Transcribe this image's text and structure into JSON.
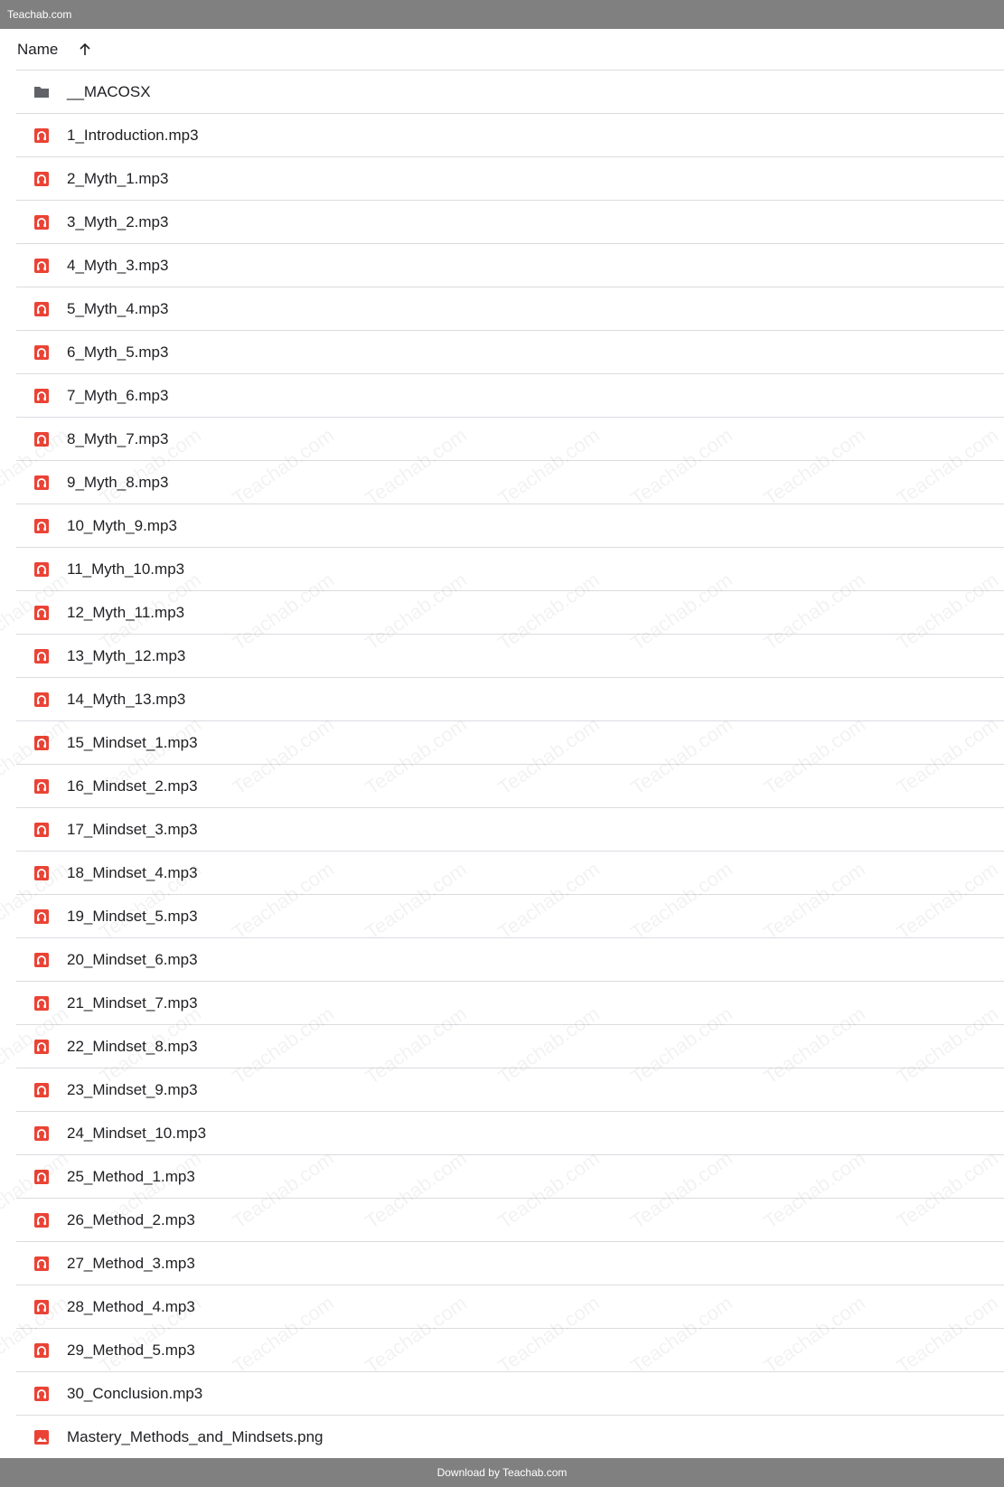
{
  "window": {
    "title": "Teachab.com",
    "footer": "Download by Teachab.com"
  },
  "watermark": {
    "text": "Teachab.com"
  },
  "list": {
    "column_header": "Name",
    "sort_direction": "ascending",
    "items": [
      {
        "name": "__MACOSX",
        "type": "folder"
      },
      {
        "name": "1_Introduction.mp3",
        "type": "audio"
      },
      {
        "name": "2_Myth_1.mp3",
        "type": "audio"
      },
      {
        "name": "3_Myth_2.mp3",
        "type": "audio"
      },
      {
        "name": "4_Myth_3.mp3",
        "type": "audio"
      },
      {
        "name": "5_Myth_4.mp3",
        "type": "audio"
      },
      {
        "name": "6_Myth_5.mp3",
        "type": "audio"
      },
      {
        "name": "7_Myth_6.mp3",
        "type": "audio"
      },
      {
        "name": "8_Myth_7.mp3",
        "type": "audio"
      },
      {
        "name": "9_Myth_8.mp3",
        "type": "audio"
      },
      {
        "name": "10_Myth_9.mp3",
        "type": "audio"
      },
      {
        "name": "11_Myth_10.mp3",
        "type": "audio"
      },
      {
        "name": "12_Myth_11.mp3",
        "type": "audio"
      },
      {
        "name": "13_Myth_12.mp3",
        "type": "audio"
      },
      {
        "name": "14_Myth_13.mp3",
        "type": "audio"
      },
      {
        "name": "15_Mindset_1.mp3",
        "type": "audio"
      },
      {
        "name": "16_Mindset_2.mp3",
        "type": "audio"
      },
      {
        "name": "17_Mindset_3.mp3",
        "type": "audio"
      },
      {
        "name": "18_Mindset_4.mp3",
        "type": "audio"
      },
      {
        "name": "19_Mindset_5.mp3",
        "type": "audio"
      },
      {
        "name": "20_Mindset_6.mp3",
        "type": "audio"
      },
      {
        "name": "21_Mindset_7.mp3",
        "type": "audio"
      },
      {
        "name": "22_Mindset_8.mp3",
        "type": "audio"
      },
      {
        "name": "23_Mindset_9.mp3",
        "type": "audio"
      },
      {
        "name": "24_Mindset_10.mp3",
        "type": "audio"
      },
      {
        "name": "25_Method_1.mp3",
        "type": "audio"
      },
      {
        "name": "26_Method_2.mp3",
        "type": "audio"
      },
      {
        "name": "27_Method_3.mp3",
        "type": "audio"
      },
      {
        "name": "28_Method_4.mp3",
        "type": "audio"
      },
      {
        "name": "29_Method_5.mp3",
        "type": "audio"
      },
      {
        "name": "30_Conclusion.mp3",
        "type": "audio"
      },
      {
        "name": "Mastery_Methods_and_Mindsets.png",
        "type": "image"
      }
    ]
  },
  "icons": {
    "folder": "folder-icon",
    "audio": "audio-file-icon",
    "image": "image-file-icon"
  },
  "colors": {
    "bar": "#808080",
    "file_icon_red": "#ea4335",
    "folder_icon": "#5f6368",
    "divider": "#dadce0"
  }
}
